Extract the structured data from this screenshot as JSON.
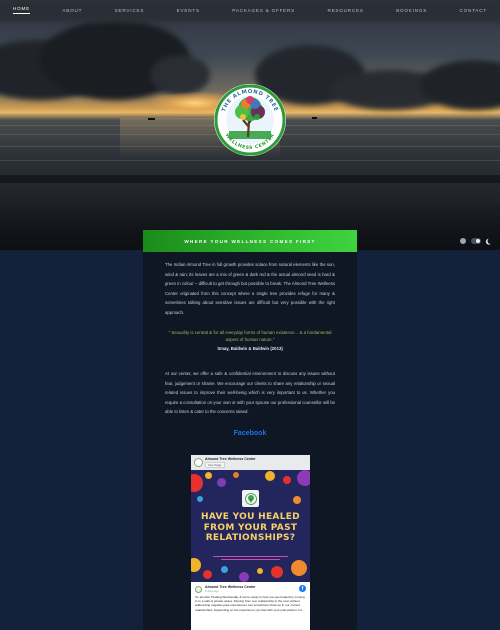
{
  "nav": {
    "items": [
      {
        "label": "Home",
        "active": true
      },
      {
        "label": "About"
      },
      {
        "label": "Services"
      },
      {
        "label": "Events"
      },
      {
        "label": "Packages & Offers"
      },
      {
        "label": "Resources"
      },
      {
        "label": "Bookings"
      },
      {
        "label": "Contact"
      }
    ]
  },
  "logo": {
    "top_text": "THE ALMOND TREE",
    "bottom_text": "WELLNESS CENTER"
  },
  "tagline": "Where your wellness comes first",
  "intro_paragraph": "The Indian Almond Tree in full growth provides solace from natural elements like the sun, wind & rain; its leaves are a mix of green & dark red & the actual almond seed is hard & green in colour – difficult to get through but possible to break. The Almond Tree Wellness Center originated from this concept where a single tree provides refuge for many & sometimes talking about sensitive issues are difficult but very possible with the right approach.",
  "quote": {
    "text": "\" Sexuality is central & for all everyday forms of human existence... & a fundamental aspect of human nature.\"",
    "citation": "Smay, Baldwin & Baldwin (2013)"
  },
  "second_paragraph": "At our center, we offer a safe & confidential environment to discuss any issues without fear, judgement or shame. We encourage our clients to share any relationship or sexual related issues to improve their well-being which is very important to us. Whether you require a consultation on your own or with your spouse our professional counsellor will be able to listen & cater to the concerns raised.",
  "facebook_heading": "Facebook",
  "facebook_embed": {
    "page_name": "Almond Tree Wellness Center",
    "like_label": "Like Page",
    "poster_title": "HAVE YOU HEALED FROM YOUR PAST RELATIONSHIPS?",
    "post_author": "Almond Tree Wellness Center",
    "post_time": "6 days ago",
    "post_text": "It's another Healing Wednesday & we're ready to help you get healed by coming in to a safe & private space. Moving from one relationship to the next without addressing negative past experiences can sometimes show up in our current relationships. Depending on the experience you had with your past partner, it's..."
  },
  "colors": {
    "accent_green": "#2fb62f",
    "page_background": "#14213a",
    "facebook_blue": "#1877f2",
    "poster_title": "#f7d06a"
  },
  "icons": {
    "theme_light": "sun-icon",
    "theme_dark": "moon-icon"
  }
}
